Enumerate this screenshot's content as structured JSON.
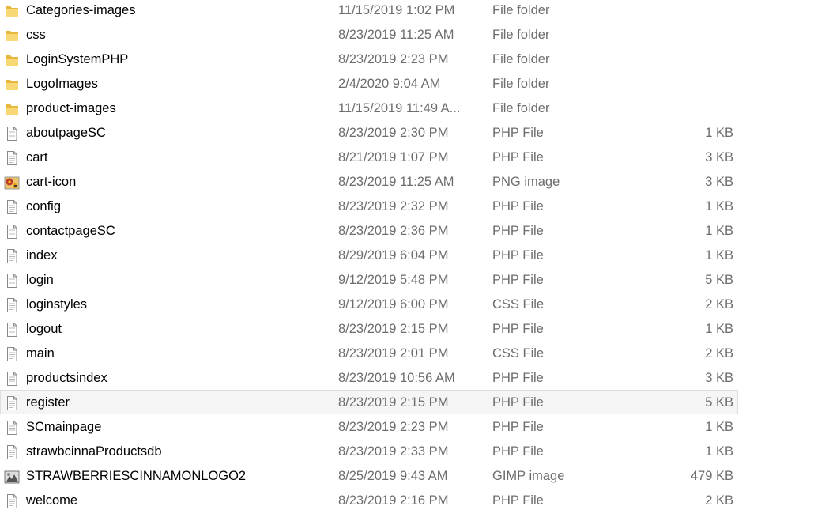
{
  "files": [
    {
      "name": "Categories-images",
      "date": "11/15/2019 1:02 PM",
      "type": "File folder",
      "size": "",
      "icon": "folder-icon"
    },
    {
      "name": "css",
      "date": "8/23/2019 11:25 AM",
      "type": "File folder",
      "size": "",
      "icon": "folder-icon"
    },
    {
      "name": "LoginSystemPHP",
      "date": "8/23/2019 2:23 PM",
      "type": "File folder",
      "size": "",
      "icon": "folder-icon"
    },
    {
      "name": "LogoImages",
      "date": "2/4/2020 9:04 AM",
      "type": "File folder",
      "size": "",
      "icon": "folder-icon"
    },
    {
      "name": "product-images",
      "date": "11/15/2019 11:49 A...",
      "type": "File folder",
      "size": "",
      "icon": "folder-icon"
    },
    {
      "name": "aboutpageSC",
      "date": "8/23/2019 2:30 PM",
      "type": "PHP File",
      "size": "1 KB",
      "icon": "file-icon"
    },
    {
      "name": "cart",
      "date": "8/21/2019 1:07 PM",
      "type": "PHP File",
      "size": "3 KB",
      "icon": "file-icon"
    },
    {
      "name": "cart-icon",
      "date": "8/23/2019 11:25 AM",
      "type": "PNG image",
      "size": "3 KB",
      "icon": "image-icon"
    },
    {
      "name": "config",
      "date": "8/23/2019 2:32 PM",
      "type": "PHP File",
      "size": "1 KB",
      "icon": "file-icon"
    },
    {
      "name": "contactpageSC",
      "date": "8/23/2019 2:36 PM",
      "type": "PHP File",
      "size": "1 KB",
      "icon": "file-icon"
    },
    {
      "name": "index",
      "date": "8/29/2019 6:04 PM",
      "type": "PHP File",
      "size": "1 KB",
      "icon": "file-icon"
    },
    {
      "name": "login",
      "date": "9/12/2019 5:48 PM",
      "type": "PHP File",
      "size": "5 KB",
      "icon": "file-icon"
    },
    {
      "name": "loginstyles",
      "date": "9/12/2019 6:00 PM",
      "type": "CSS File",
      "size": "2 KB",
      "icon": "file-icon"
    },
    {
      "name": "logout",
      "date": "8/23/2019 2:15 PM",
      "type": "PHP File",
      "size": "1 KB",
      "icon": "file-icon"
    },
    {
      "name": "main",
      "date": "8/23/2019 2:01 PM",
      "type": "CSS File",
      "size": "2 KB",
      "icon": "file-icon"
    },
    {
      "name": "productsindex",
      "date": "8/23/2019 10:56 AM",
      "type": "PHP File",
      "size": "3 KB",
      "icon": "file-icon"
    },
    {
      "name": "register",
      "date": "8/23/2019 2:15 PM",
      "type": "PHP File",
      "size": "5 KB",
      "icon": "file-icon",
      "hover": true
    },
    {
      "name": "SCmainpage",
      "date": "8/23/2019 2:23 PM",
      "type": "PHP File",
      "size": "1 KB",
      "icon": "file-icon"
    },
    {
      "name": "strawbcinnaProductsdb",
      "date": "8/23/2019 2:33 PM",
      "type": "PHP File",
      "size": "1 KB",
      "icon": "file-icon"
    },
    {
      "name": "STRAWBERRIESCINNAMONLOGO2",
      "date": "8/25/2019 9:43 AM",
      "type": "GIMP image",
      "size": "479 KB",
      "icon": "gimp-icon"
    },
    {
      "name": "welcome",
      "date": "8/23/2019 2:16 PM",
      "type": "PHP File",
      "size": "2 KB",
      "icon": "file-icon"
    }
  ]
}
